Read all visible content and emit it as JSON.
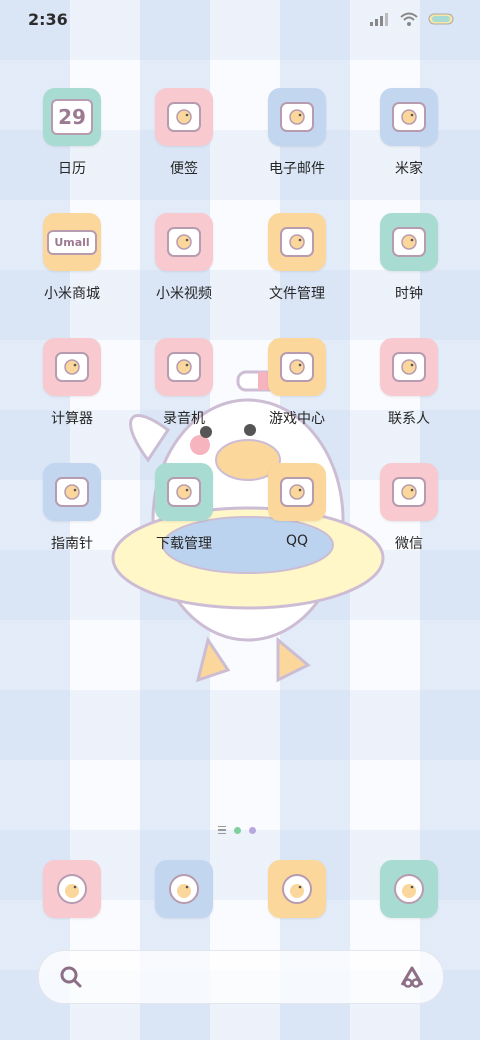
{
  "status_bar": {
    "time": "2:36",
    "icons": [
      "signal-icon",
      "wifi-icon",
      "battery-icon"
    ]
  },
  "apps": [
    {
      "id": "calendar",
      "label": "日历",
      "icon": "calendar-icon",
      "color": "#a8dbd2",
      "glyph": "29"
    },
    {
      "id": "notes",
      "label": "便签",
      "icon": "notes-icon",
      "color": "#f8c9cf",
      "glyph": ""
    },
    {
      "id": "email",
      "label": "电子邮件",
      "icon": "email-icon",
      "color": "#c3d6ef",
      "glyph": ""
    },
    {
      "id": "mihome",
      "label": "米家",
      "icon": "home-icon",
      "color": "#c3d6ef",
      "glyph": ""
    },
    {
      "id": "mall",
      "label": "小米商城",
      "icon": "mall-icon",
      "color": "#fbd79b",
      "glyph": "Umall"
    },
    {
      "id": "video",
      "label": "小米视频",
      "icon": "tv-icon",
      "color": "#f8c9cf",
      "glyph": ""
    },
    {
      "id": "files",
      "label": "文件管理",
      "icon": "folder-icon",
      "color": "#fbd79b",
      "glyph": ""
    },
    {
      "id": "clock",
      "label": "时钟",
      "icon": "clock-icon",
      "color": "#a8dbd2",
      "glyph": ""
    },
    {
      "id": "calculator",
      "label": "计算器",
      "icon": "calculator-icon",
      "color": "#f8c9cf",
      "glyph": ""
    },
    {
      "id": "recorder",
      "label": "录音机",
      "icon": "recorder-icon",
      "color": "#f8c9cf",
      "glyph": ""
    },
    {
      "id": "games",
      "label": "游戏中心",
      "icon": "game-icon",
      "color": "#fbd79b",
      "glyph": ""
    },
    {
      "id": "contacts",
      "label": "联系人",
      "icon": "contacts-icon",
      "color": "#f8c9cf",
      "glyph": ""
    },
    {
      "id": "compass",
      "label": "指南针",
      "icon": "compass-icon",
      "color": "#c3d6ef",
      "glyph": ""
    },
    {
      "id": "downloads",
      "label": "下载管理",
      "icon": "download-icon",
      "color": "#a8dbd2",
      "glyph": ""
    },
    {
      "id": "qq",
      "label": "QQ",
      "icon": "qq-icon",
      "color": "#fbd79b",
      "glyph": ""
    },
    {
      "id": "wechat",
      "label": "微信",
      "icon": "wechat-icon",
      "color": "#f8c9cf",
      "glyph": ""
    }
  ],
  "page_indicator": {
    "active_color": "#7fcf9f",
    "inactive_color": "#b7a7e0"
  },
  "dock": [
    {
      "id": "phone",
      "icon": "phone-icon",
      "color": "#f8c9cf"
    },
    {
      "id": "browser",
      "icon": "basketball-duck-icon",
      "color": "#c3d6ef"
    },
    {
      "id": "messages",
      "icon": "message-icon",
      "color": "#fbd79b"
    },
    {
      "id": "camera",
      "icon": "camera-icon",
      "color": "#a8dbd2"
    }
  ],
  "search": {
    "left_icon": "search-icon",
    "right_icon": "assistant-icon"
  }
}
